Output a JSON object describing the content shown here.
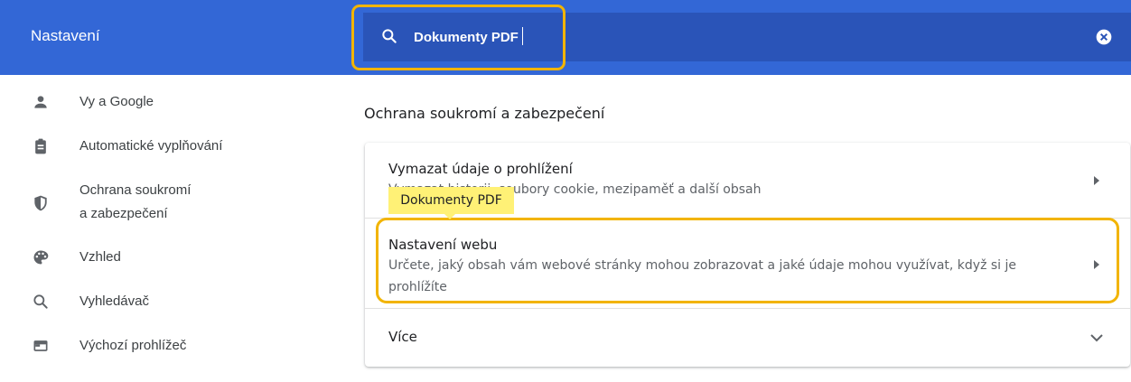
{
  "header": {
    "title": "Nastavení",
    "search_value": "Dokumenty PDF",
    "search_icon": "search-icon",
    "clear_icon": "clear-icon"
  },
  "sidebar": {
    "items": [
      {
        "label": "Vy a Google",
        "icon": "person-icon"
      },
      {
        "label": "Automatické vyplňování",
        "icon": "clipboard-icon"
      },
      {
        "label_line1": "Ochrana soukromí",
        "label_line2": "a zabezpečení",
        "icon": "shield-icon"
      },
      {
        "label": "Vzhled",
        "icon": "palette-icon"
      },
      {
        "label": "Vyhledávač",
        "icon": "search-icon"
      },
      {
        "label": "Výchozí prohlížeč",
        "icon": "browser-icon"
      }
    ]
  },
  "main": {
    "section_title": "Ochrana soukromí a zabezpečení",
    "rows": [
      {
        "title": "Vymazat údaje o prohlížení",
        "subtitle": "Vymazat historii, soubory cookie, mezipaměť a další obsah"
      },
      {
        "title": "Nastavení webu",
        "subtitle": "Určete, jaký obsah vám webové stránky mohou zobrazovat a jaké údaje mohou využívat, když si je prohlížíte"
      },
      {
        "title": "Více"
      }
    ],
    "tooltip": "Dokumenty PDF"
  },
  "colors": {
    "header_blue": "#3367d6",
    "search_blue": "#2a54b8",
    "highlight": "#f2b400",
    "tooltip": "#fff176"
  }
}
